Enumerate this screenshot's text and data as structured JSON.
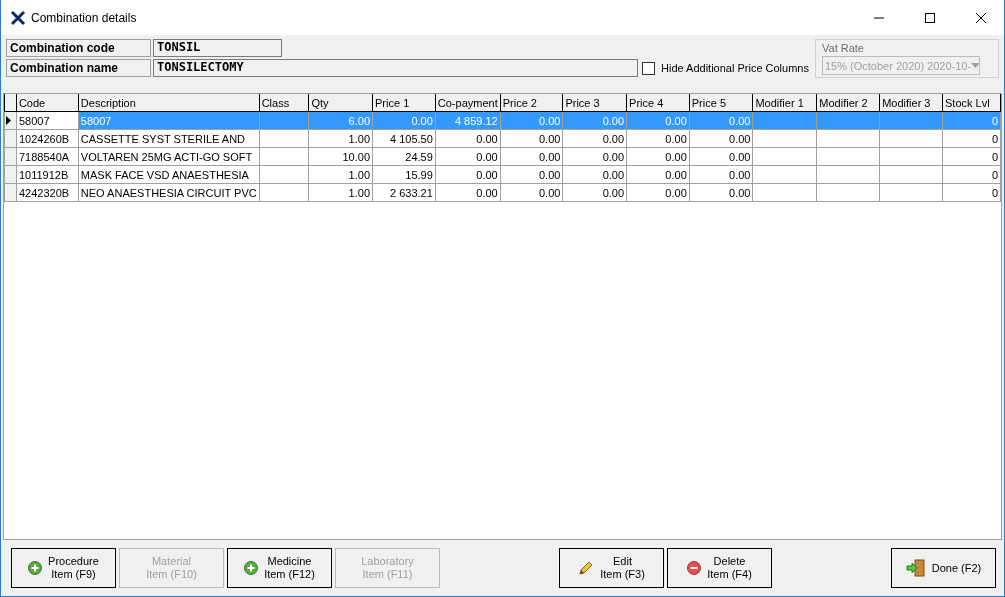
{
  "window": {
    "title": "Combination details"
  },
  "header": {
    "code_label": "Combination code",
    "code_value": "TONSIL",
    "name_label": "Combination name",
    "name_value": "TONSILECTOMY",
    "hide_price_columns": {
      "label": "Hide Additional Price Columns",
      "checked": false
    },
    "vat_rate": {
      "label": "Vat Rate",
      "value": "15% (October 2020) 2020-10-",
      "disabled": true
    }
  },
  "table": {
    "columns": [
      "Code",
      "Description",
      "Class",
      "Qty",
      "Price 1",
      "Co-payment",
      "Price 2",
      "Price 3",
      "Price 4",
      "Price 5",
      "Modifier 1",
      "Modifier 2",
      "Modifier 3",
      "Stock Lvl"
    ],
    "rows": [
      {
        "selected": true,
        "cells": [
          "58007",
          "58007",
          "",
          "6.00",
          "0.00",
          "4 859.12",
          "0.00",
          "0.00",
          "0.00",
          "0.00",
          "",
          "",
          "",
          "0"
        ]
      },
      {
        "selected": false,
        "cells": [
          "1024260B",
          "CASSETTE SYST STERILE AND",
          "",
          "1.00",
          "4 105.50",
          "0.00",
          "0.00",
          "0.00",
          "0.00",
          "0.00",
          "",
          "",
          "",
          "0"
        ]
      },
      {
        "selected": false,
        "cells": [
          "7188540A",
          "VOLTAREN 25MG ACTI-GO SOFT",
          "",
          "10.00",
          "24.59",
          "0.00",
          "0.00",
          "0.00",
          "0.00",
          "0.00",
          "",
          "",
          "",
          "0"
        ]
      },
      {
        "selected": false,
        "cells": [
          "1011912B",
          "MASK FACE VSD ANAESTHESIA",
          "",
          "1.00",
          "15.99",
          "0.00",
          "0.00",
          "0.00",
          "0.00",
          "0.00",
          "",
          "",
          "",
          "0"
        ]
      },
      {
        "selected": false,
        "cells": [
          "4242320B",
          "NEO ANAESTHESIA CIRCUIT PVC",
          "",
          "1.00",
          "2 633.21",
          "0.00",
          "0.00",
          "0.00",
          "0.00",
          "0.00",
          "",
          "",
          "",
          "0"
        ]
      }
    ]
  },
  "buttons": [
    {
      "label": "Procedure\nItem (F9)",
      "kind": "add",
      "disabled": false
    },
    {
      "label": "Material\nItem (F10)",
      "kind": "plain",
      "disabled": true
    },
    {
      "label": "Medicine\nItem (F12)",
      "kind": "add",
      "disabled": false
    },
    {
      "label": "Laboratory\nItem (F11)",
      "kind": "plain",
      "disabled": true
    },
    {
      "label": "Edit\nItem (F3)",
      "kind": "edit",
      "disabled": false
    },
    {
      "label": "Delete\nItem (F4)",
      "kind": "delete",
      "disabled": false
    },
    {
      "label": "Done (F2)",
      "kind": "exit",
      "disabled": false
    }
  ]
}
